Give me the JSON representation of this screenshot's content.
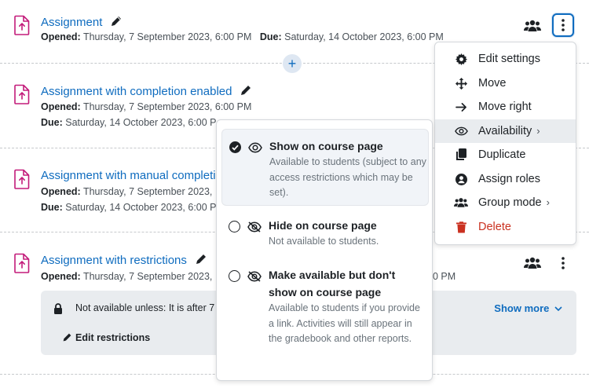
{
  "activities": [
    {
      "title": "Assignment",
      "opened_label": "Opened:",
      "opened_value": "Thursday, 7 September 2023, 6:00 PM",
      "due_label": "Due:",
      "due_value": "Saturday, 14 October 2023, 6:00 PM"
    },
    {
      "title": "Assignment with completion enabled",
      "opened_label": "Opened:",
      "opened_value": "Thursday, 7 September 2023, 6:00 PM",
      "due_label": "Due:",
      "due_value": "Saturday, 14 October 2023, 6:00 P"
    },
    {
      "title": "Assignment with manual completi",
      "opened_label": "Opened:",
      "opened_value": "Thursday, 7 September 2023,",
      "due_label": "Due:",
      "due_value": "Saturday, 14 October 2023, 6:00 P"
    },
    {
      "title": "Assignment with restrictions",
      "opened_label": "Opened:",
      "opened_value": "Thursday, 7 September 2023,",
      "due_tail": "0 PM",
      "restriction_text": "Not available unless: It is after 7",
      "show_more": "Show more",
      "edit_restrictions": "Edit restrictions"
    }
  ],
  "add_button": "+",
  "action_menu": {
    "items": [
      {
        "label": "Edit settings",
        "icon": "gear-icon"
      },
      {
        "label": "Move",
        "icon": "move-arrows-icon"
      },
      {
        "label": "Move right",
        "icon": "arrow-right-icon"
      },
      {
        "label": "Availability",
        "icon": "eye-icon",
        "chevron": "›"
      },
      {
        "label": "Duplicate",
        "icon": "copy-icon"
      },
      {
        "label": "Assign roles",
        "icon": "user-circle-icon"
      },
      {
        "label": "Group mode",
        "icon": "group-icon",
        "chevron": "›"
      },
      {
        "label": "Delete",
        "icon": "trash-icon"
      }
    ]
  },
  "availability_menu": {
    "options": [
      {
        "title": "Show on course page",
        "description": "Available to students (subject to any access restrictions which may be set).",
        "selected": true
      },
      {
        "title": "Hide on course page",
        "description": "Not available to students.",
        "selected": false
      },
      {
        "title": "Make available but don't show on course page",
        "description": "Available to students if you provide a link. Activities will still appear in the gradebook and other reports.",
        "selected": false
      }
    ]
  },
  "colors": {
    "link": "#0f6cbf",
    "assignment_icon": "#c31b7a",
    "danger": "#ca3120",
    "text": "#1d2125",
    "muted": "#6a737b"
  }
}
